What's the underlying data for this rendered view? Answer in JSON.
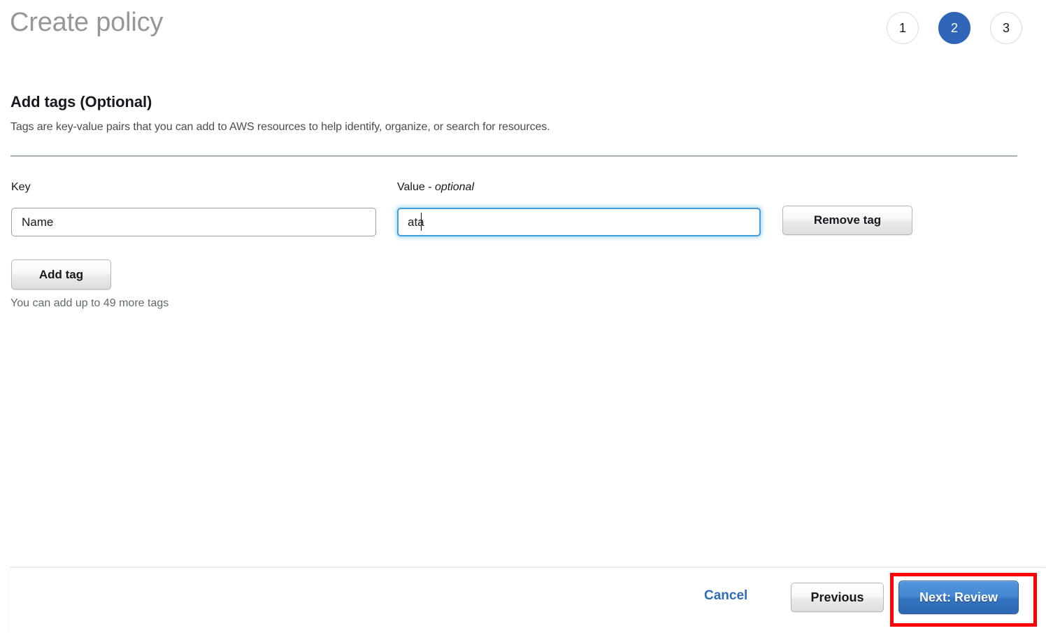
{
  "header": {
    "title": "Create policy",
    "steps": [
      {
        "label": "1",
        "active": false
      },
      {
        "label": "2",
        "active": true
      },
      {
        "label": "3",
        "active": false
      }
    ]
  },
  "section": {
    "heading": "Add tags (Optional)",
    "description": "Tags are key-value pairs that you can add to AWS resources to help identify, organize, or search for resources."
  },
  "tag_row": {
    "key_label": "Key",
    "key_value": "Name",
    "key_placeholder": "",
    "value_label_prefix": "Value - ",
    "value_label_optional": "optional",
    "value_value": "ata",
    "value_placeholder": "",
    "remove_tag_label": "Remove tag"
  },
  "actions": {
    "add_tag_label": "Add tag",
    "helper_text": "You can add up to 49 more tags"
  },
  "footer": {
    "cancel_label": "Cancel",
    "previous_label": "Previous",
    "next_label": "Next: Review"
  },
  "colors": {
    "accent_blue": "#3066b8",
    "link_blue": "#2f6cb8",
    "focus_blue": "#3f9fd8",
    "highlight_red": "#fb0007",
    "title_gray": "#979797",
    "divider_gray": "#aab2b5"
  }
}
